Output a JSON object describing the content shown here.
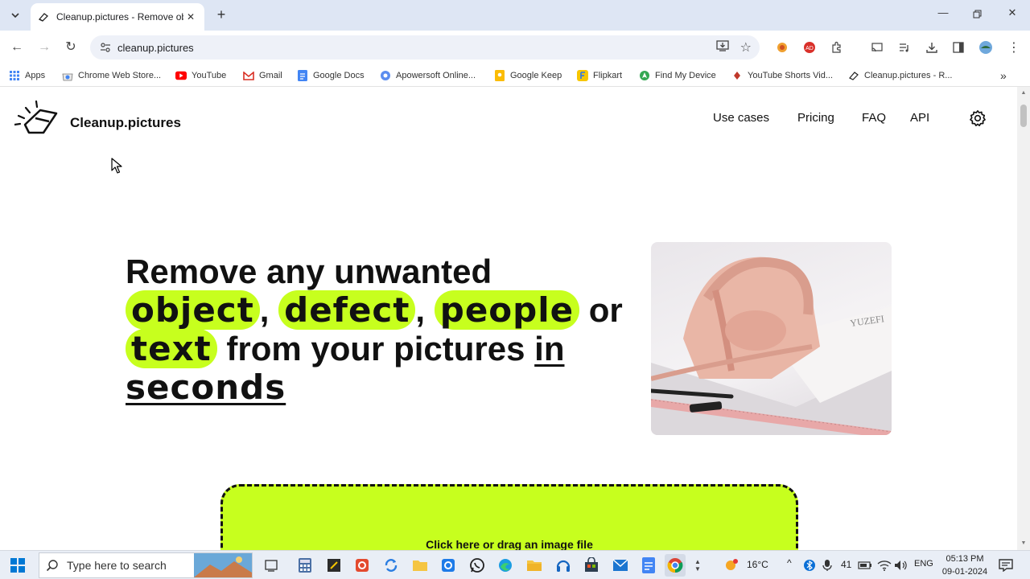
{
  "browser": {
    "tab_title": "Cleanup.pictures - Remove obj",
    "url": "cleanup.pictures",
    "bookmarks": [
      {
        "label": "Apps",
        "icon": "apps-grid-icon"
      },
      {
        "label": "Chrome Web Store...",
        "icon": "chrome-webstore-icon"
      },
      {
        "label": "YouTube",
        "icon": "youtube-icon"
      },
      {
        "label": "Gmail",
        "icon": "gmail-icon"
      },
      {
        "label": "Google Docs",
        "icon": "google-docs-icon"
      },
      {
        "label": "Apowersoft Online...",
        "icon": "apowersoft-icon"
      },
      {
        "label": "Google Keep",
        "icon": "google-keep-icon"
      },
      {
        "label": "Flipkart",
        "icon": "flipkart-icon"
      },
      {
        "label": "Find My Device",
        "icon": "find-my-device-icon"
      },
      {
        "label": "YouTube Shorts Vid...",
        "icon": "youtube-shorts-icon"
      },
      {
        "label": "Cleanup.pictures - R...",
        "icon": "cleanup-pictures-icon"
      }
    ]
  },
  "site": {
    "brand": "Cleanup.pictures",
    "nav": [
      "Use cases",
      "Pricing",
      "FAQ",
      "API"
    ],
    "hero": {
      "line1": "Remove any unwanted",
      "word_object": "object",
      "comma1": ",",
      "word_defect": "defect",
      "comma2": ",",
      "word_people": "people",
      "word_or": "or",
      "word_text": "text",
      "middle": "from your pictures",
      "word_in": "in",
      "word_seconds": "seconds"
    },
    "upload_label": "Click here or drag an image file",
    "accent_color": "#c7ff1e"
  },
  "taskbar": {
    "search_placeholder": "Type here to search",
    "weather": "16°C",
    "badge_count": "41",
    "language": "ENG",
    "time": "05:13 PM",
    "date": "09-01-2024"
  }
}
